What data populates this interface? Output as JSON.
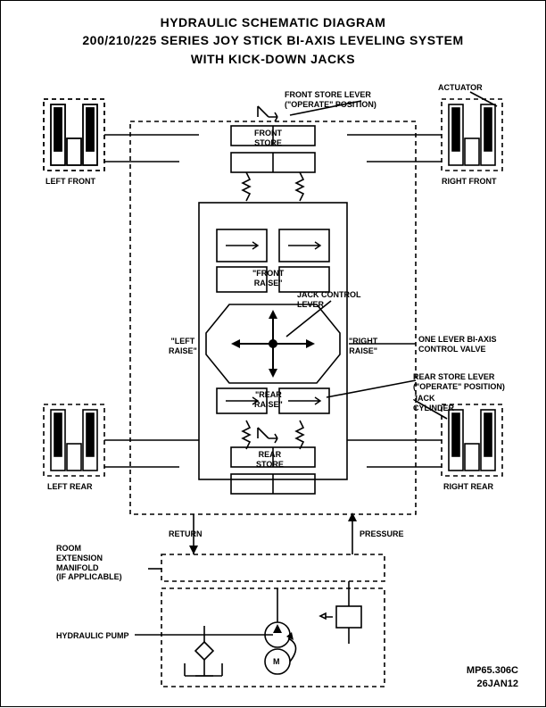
{
  "title": {
    "line1": "HYDRAULIC SCHEMATIC DIAGRAM",
    "line2": "200/210/225 SERIES JOY STICK BI-AXIS LEVELING SYSTEM",
    "line3": "WITH KICK-DOWN JACKS"
  },
  "labels": {
    "actuator": "ACTUATOR",
    "front_store_lever": "FRONT STORE LEVER\n(\"OPERATE\" POSITION)",
    "front_store": "FRONT\nSTORE",
    "left_front": "LEFT FRONT",
    "right_front": "RIGHT FRONT",
    "front_raise": "\"FRONT\nRAISE\"",
    "jack_control_lever": "JACK CONTROL\nLEVER",
    "left_raise": "\"LEFT\nRAISE\"",
    "right_raise": "\"RIGHT\nRAISE\"",
    "one_lever": "ONE LEVER BI-AXIS\nCONTROL VALVE",
    "rear_store_lever": "REAR STORE LEVER\n(\"OPERATE\" POSITION)",
    "jack_cylinder": "JACK\nCYLINDER",
    "rear_raise": "\"REAR\nRAISE\"",
    "rear_store": "REAR\nSTORE",
    "left_rear": "LEFT REAR",
    "right_rear": "RIGHT REAR",
    "return": "RETURN",
    "pressure": "PRESSURE",
    "room_ext": "ROOM\nEXTENSION\nMANIFOLD\n(IF APPLICABLE)",
    "hydraulic_pump": "HYDRAULIC PUMP",
    "motor": "M"
  },
  "footer": {
    "code": "MP65.306C",
    "date": "26JAN12"
  }
}
